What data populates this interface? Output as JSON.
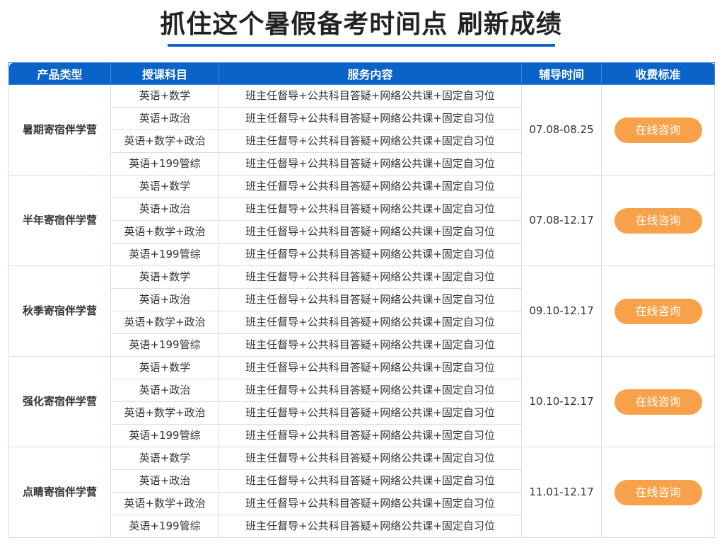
{
  "page_title": "抓住这个暑假备考时间点 刷新成绩",
  "columns": [
    "产品类型",
    "授课科目",
    "服务内容",
    "辅导时间",
    "收费标准"
  ],
  "groups": [
    {
      "product": "暑期寄宿伴学营",
      "period": "07.08-08.25",
      "button": "在线咨询",
      "rows": [
        {
          "subject": "英语+数学",
          "service": "班主任督导+公共科目答疑+网络公共课+固定自习位"
        },
        {
          "subject": "英语+政治",
          "service": "班主任督导+公共科目答疑+网络公共课+固定自习位"
        },
        {
          "subject": "英语+数学+政治",
          "service": "班主任督导+公共科目答疑+网络公共课+固定自习位"
        },
        {
          "subject": "英语+199管综",
          "service": "班主任督导+公共科目答疑+网络公共课+固定自习位"
        }
      ]
    },
    {
      "product": "半年寄宿伴学营",
      "period": "07.08-12.17",
      "button": "在线咨询",
      "rows": [
        {
          "subject": "英语+数学",
          "service": "班主任督导+公共科目答疑+网络公共课+固定自习位"
        },
        {
          "subject": "英语+政治",
          "service": "班主任督导+公共科目答疑+网络公共课+固定自习位"
        },
        {
          "subject": "英语+数学+政治",
          "service": "班主任督导+公共科目答疑+网络公共课+固定自习位"
        },
        {
          "subject": "英语+199管综",
          "service": "班主任督导+公共科目答疑+网络公共课+固定自习位"
        }
      ]
    },
    {
      "product": "秋季寄宿伴学营",
      "period": "09.10-12.17",
      "button": "在线咨询",
      "rows": [
        {
          "subject": "英语+数学",
          "service": "班主任督导+公共科目答疑+网络公共课+固定自习位"
        },
        {
          "subject": "英语+政治",
          "service": "班主任督导+公共科目答疑+网络公共课+固定自习位"
        },
        {
          "subject": "英语+数学+政治",
          "service": "班主任督导+公共科目答疑+网络公共课+固定自习位"
        },
        {
          "subject": "英语+199管综",
          "service": "班主任督导+公共科目答疑+网络公共课+固定自习位"
        }
      ]
    },
    {
      "product": "强化寄宿伴学营",
      "period": "10.10-12.17",
      "button": "在线咨询",
      "rows": [
        {
          "subject": "英语+数学",
          "service": "班主任督导+公共科目答疑+网络公共课+固定自习位"
        },
        {
          "subject": "英语+政治",
          "service": "班主任督导+公共科目答疑+网络公共课+固定自习位"
        },
        {
          "subject": "英语+数学+政治",
          "service": "班主任督导+公共科目答疑+网络公共课+固定自习位"
        },
        {
          "subject": "英语+199管综",
          "service": "班主任督导+公共科目答疑+网络公共课+固定自习位"
        }
      ]
    },
    {
      "product": "点睛寄宿伴学营",
      "period": "11.01-12.17",
      "button": "在线咨询",
      "rows": [
        {
          "subject": "英语+数学",
          "service": "班主任督导+公共科目答疑+网络公共课+固定自习位"
        },
        {
          "subject": "英语+政治",
          "service": "班主任督导+公共科目答疑+网络公共课+固定自习位"
        },
        {
          "subject": "英语+数学+政治",
          "service": "班主任督导+公共科目答疑+网络公共课+固定自习位"
        },
        {
          "subject": "英语+199管综",
          "service": "班主任督导+公共科目答疑+网络公共课+固定自习位"
        }
      ]
    }
  ],
  "colors": {
    "header_blue": "#0a63c9",
    "button_orange": "#f7a24a",
    "border": "#cfe1f3"
  }
}
